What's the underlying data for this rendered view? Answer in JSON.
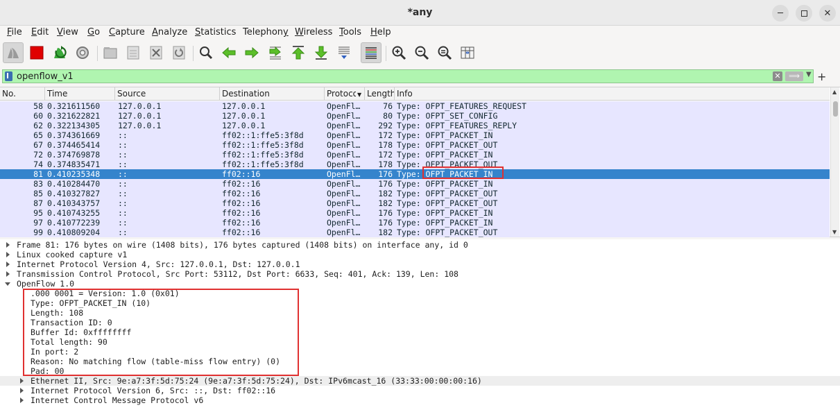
{
  "window": {
    "title": "*any"
  },
  "menu": [
    {
      "label": "File",
      "u": "F",
      "rest": "ile"
    },
    {
      "label": "Edit",
      "u": "E",
      "rest": "dit"
    },
    {
      "label": "View",
      "u": "V",
      "rest": "iew"
    },
    {
      "label": "Go",
      "u": "G",
      "rest": "o"
    },
    {
      "label": "Capture",
      "u": "C",
      "rest": "apture"
    },
    {
      "label": "Analyze",
      "u": "A",
      "rest": "nalyze"
    },
    {
      "label": "Statistics",
      "u": "S",
      "rest": "tatistics"
    },
    {
      "label": "Telephony",
      "u": "",
      "rest": "Telephon",
      "u2": "y"
    },
    {
      "label": "Wireless",
      "u": "W",
      "rest": "ireless"
    },
    {
      "label": "Tools",
      "u": "T",
      "rest": "ools"
    },
    {
      "label": "Help",
      "u": "H",
      "rest": "elp"
    }
  ],
  "toolbar_icons": [
    "shark-fin-start-icon",
    "stop-capture-icon",
    "restart-capture-icon",
    "capture-options-icon",
    "open-file-icon",
    "save-file-icon",
    "close-file-icon",
    "reload-file-icon",
    "find-packet-icon",
    "go-back-icon",
    "go-forward-icon",
    "go-to-packet-icon",
    "go-first-packet-icon",
    "go-last-packet-icon",
    "auto-scroll-icon",
    "colorize-icon",
    "zoom-in-icon",
    "zoom-out-icon",
    "zoom-normal-icon",
    "resize-columns-icon"
  ],
  "filter": {
    "value": "openflow_v1",
    "bg_color": "#b0f5b0"
  },
  "packet_list": {
    "columns": [
      "No.",
      "Time",
      "Source",
      "Destination",
      "Protocol",
      "Length",
      "Info"
    ],
    "rows": [
      {
        "no": "58",
        "time": "0.321611560",
        "src": "127.0.0.1",
        "dst": "127.0.0.1",
        "proto": "OpenFl…",
        "len": "76",
        "info": "Type: OFPT_FEATURES_REQUEST"
      },
      {
        "no": "60",
        "time": "0.321622821",
        "src": "127.0.0.1",
        "dst": "127.0.0.1",
        "proto": "OpenFl…",
        "len": "80",
        "info": "Type: OFPT_SET_CONFIG"
      },
      {
        "no": "62",
        "time": "0.322134305",
        "src": "127.0.0.1",
        "dst": "127.0.0.1",
        "proto": "OpenFl…",
        "len": "292",
        "info": "Type: OFPT_FEATURES_REPLY"
      },
      {
        "no": "65",
        "time": "0.374361669",
        "src": "::",
        "dst": "ff02::1:ffe5:3f8d",
        "proto": "OpenFl…",
        "len": "172",
        "info": "Type: OFPT_PACKET_IN"
      },
      {
        "no": "67",
        "time": "0.374465414",
        "src": "::",
        "dst": "ff02::1:ffe5:3f8d",
        "proto": "OpenFl…",
        "len": "178",
        "info": "Type: OFPT_PACKET_OUT"
      },
      {
        "no": "72",
        "time": "0.374769878",
        "src": "::",
        "dst": "ff02::1:ffe5:3f8d",
        "proto": "OpenFl…",
        "len": "172",
        "info": "Type: OFPT_PACKET_IN"
      },
      {
        "no": "74",
        "time": "0.374835471",
        "src": "::",
        "dst": "ff02::1:ffe5:3f8d",
        "proto": "OpenFl…",
        "len": "178",
        "info": "Type: OFPT_PACKET_OUT"
      },
      {
        "no": "81",
        "time": "0.410235348",
        "src": "::",
        "dst": "ff02::16",
        "proto": "OpenFl…",
        "len": "176",
        "info": "Type: OFPT_PACKET_IN",
        "selected": true
      },
      {
        "no": "83",
        "time": "0.410284470",
        "src": "::",
        "dst": "ff02::16",
        "proto": "OpenFl…",
        "len": "176",
        "info": "Type: OFPT_PACKET_IN"
      },
      {
        "no": "85",
        "time": "0.410327827",
        "src": "::",
        "dst": "ff02::16",
        "proto": "OpenFl…",
        "len": "182",
        "info": "Type: OFPT_PACKET_OUT"
      },
      {
        "no": "87",
        "time": "0.410343757",
        "src": "::",
        "dst": "ff02::16",
        "proto": "OpenFl…",
        "len": "182",
        "info": "Type: OFPT_PACKET_OUT"
      },
      {
        "no": "95",
        "time": "0.410743255",
        "src": "::",
        "dst": "ff02::16",
        "proto": "OpenFl…",
        "len": "176",
        "info": "Type: OFPT_PACKET_IN"
      },
      {
        "no": "97",
        "time": "0.410772239",
        "src": "::",
        "dst": "ff02::16",
        "proto": "OpenFl…",
        "len": "176",
        "info": "Type: OFPT_PACKET_IN"
      },
      {
        "no": "99",
        "time": "0.410809204",
        "src": "::",
        "dst": "ff02::16",
        "proto": "OpenFl…",
        "len": "182",
        "info": "Type: OFPT_PACKET_OUT"
      }
    ],
    "row_bg": "#e7e6ff",
    "selected_bg": "#3584cc"
  },
  "details": [
    {
      "text": "Frame 81: 176 bytes on wire (1408 bits), 176 bytes captured (1408 bits) on interface any, id 0",
      "level": 0,
      "expander": "right"
    },
    {
      "text": "Linux cooked capture v1",
      "level": 0,
      "expander": "right"
    },
    {
      "text": "Internet Protocol Version 4, Src: 127.0.0.1, Dst: 127.0.0.1",
      "level": 0,
      "expander": "right"
    },
    {
      "text": "Transmission Control Protocol, Src Port: 53112, Dst Port: 6633, Seq: 401, Ack: 139, Len: 108",
      "level": 0,
      "expander": "right"
    },
    {
      "text": "OpenFlow 1.0",
      "level": 0,
      "expander": "down"
    },
    {
      "text": ".000 0001 = Version: 1.0 (0x01)",
      "level": 1,
      "expander": ""
    },
    {
      "text": "Type: OFPT_PACKET_IN (10)",
      "level": 1,
      "expander": ""
    },
    {
      "text": "Length: 108",
      "level": 1,
      "expander": ""
    },
    {
      "text": "Transaction ID: 0",
      "level": 1,
      "expander": ""
    },
    {
      "text": "Buffer Id: 0xffffffff",
      "level": 1,
      "expander": ""
    },
    {
      "text": "Total length: 90",
      "level": 1,
      "expander": ""
    },
    {
      "text": "In port: 2",
      "level": 1,
      "expander": ""
    },
    {
      "text": "Reason: No matching flow (table-miss flow entry) (0)",
      "level": 1,
      "expander": ""
    },
    {
      "text": "Pad: 00",
      "level": 1,
      "expander": ""
    },
    {
      "text": "Ethernet II, Src: 9e:a7:3f:5d:75:24 (9e:a7:3f:5d:75:24), Dst: IPv6mcast_16 (33:33:00:00:00:16)",
      "level": 1,
      "expander": "right",
      "shaded": true
    },
    {
      "text": "Internet Protocol Version 6, Src: ::, Dst: ff02::16",
      "level": 1,
      "expander": "right"
    },
    {
      "text": "Internet Control Message Protocol v6",
      "level": 1,
      "expander": "right"
    }
  ]
}
